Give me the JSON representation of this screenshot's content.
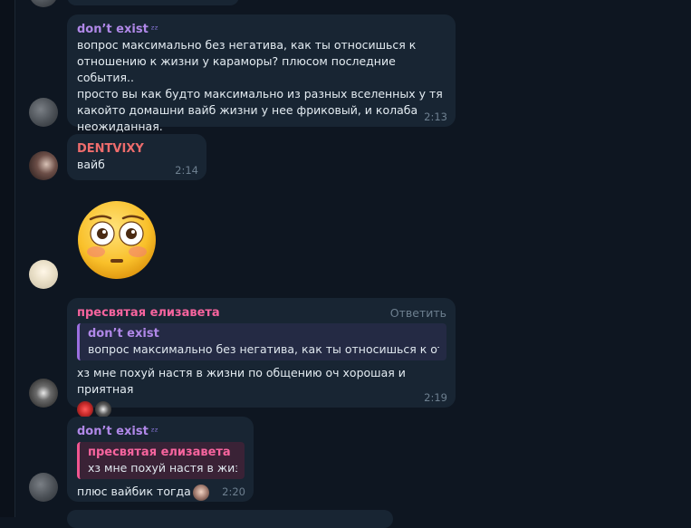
{
  "messages": {
    "m1": {
      "author": "don’t exist",
      "status_icon": "zzz-icon",
      "text": "вопрос максимально без негатива, как ты относишься к\nотношению к жизни у караморы? плюсом последние события..\nпросто вы как будто максимально из разных вселенных у тя\nкакойто домашни вайб жизни у нее фриковый, и колаба\nнеожиданная.",
      "time": "2:13"
    },
    "m2": {
      "author": "DENTVIXY",
      "text": "вайб",
      "time": "2:14"
    },
    "m3": {
      "sticker": "flushed-face-emoji"
    },
    "m4": {
      "author": "пресвятая елизавета",
      "reply_button": "Ответить",
      "reply_to_author": "don’t exist",
      "reply_to_text": "вопрос максимально без негатива, как ты относишься к отн...",
      "text": "хз мне похуй настя в жизни по общению оч хорошая и приятная",
      "reactions": [
        "heart-reaction",
        "avatar-reaction"
      ],
      "time": "2:19"
    },
    "m5": {
      "author": "don’t exist",
      "status_icon": "zzz-icon",
      "reply_to_author": "пресвятая елизавета",
      "reply_to_text": "хз мне похуй настя в жиз...",
      "text": "плюс вайбик тогда",
      "time": "2:20"
    }
  },
  "colors": {
    "background": "#0e1621",
    "bubble": "#182533",
    "name_purple": "#b088e8",
    "name_red": "#ee6c6c",
    "name_pink": "#f7649e",
    "time": "#6d7f8f"
  }
}
